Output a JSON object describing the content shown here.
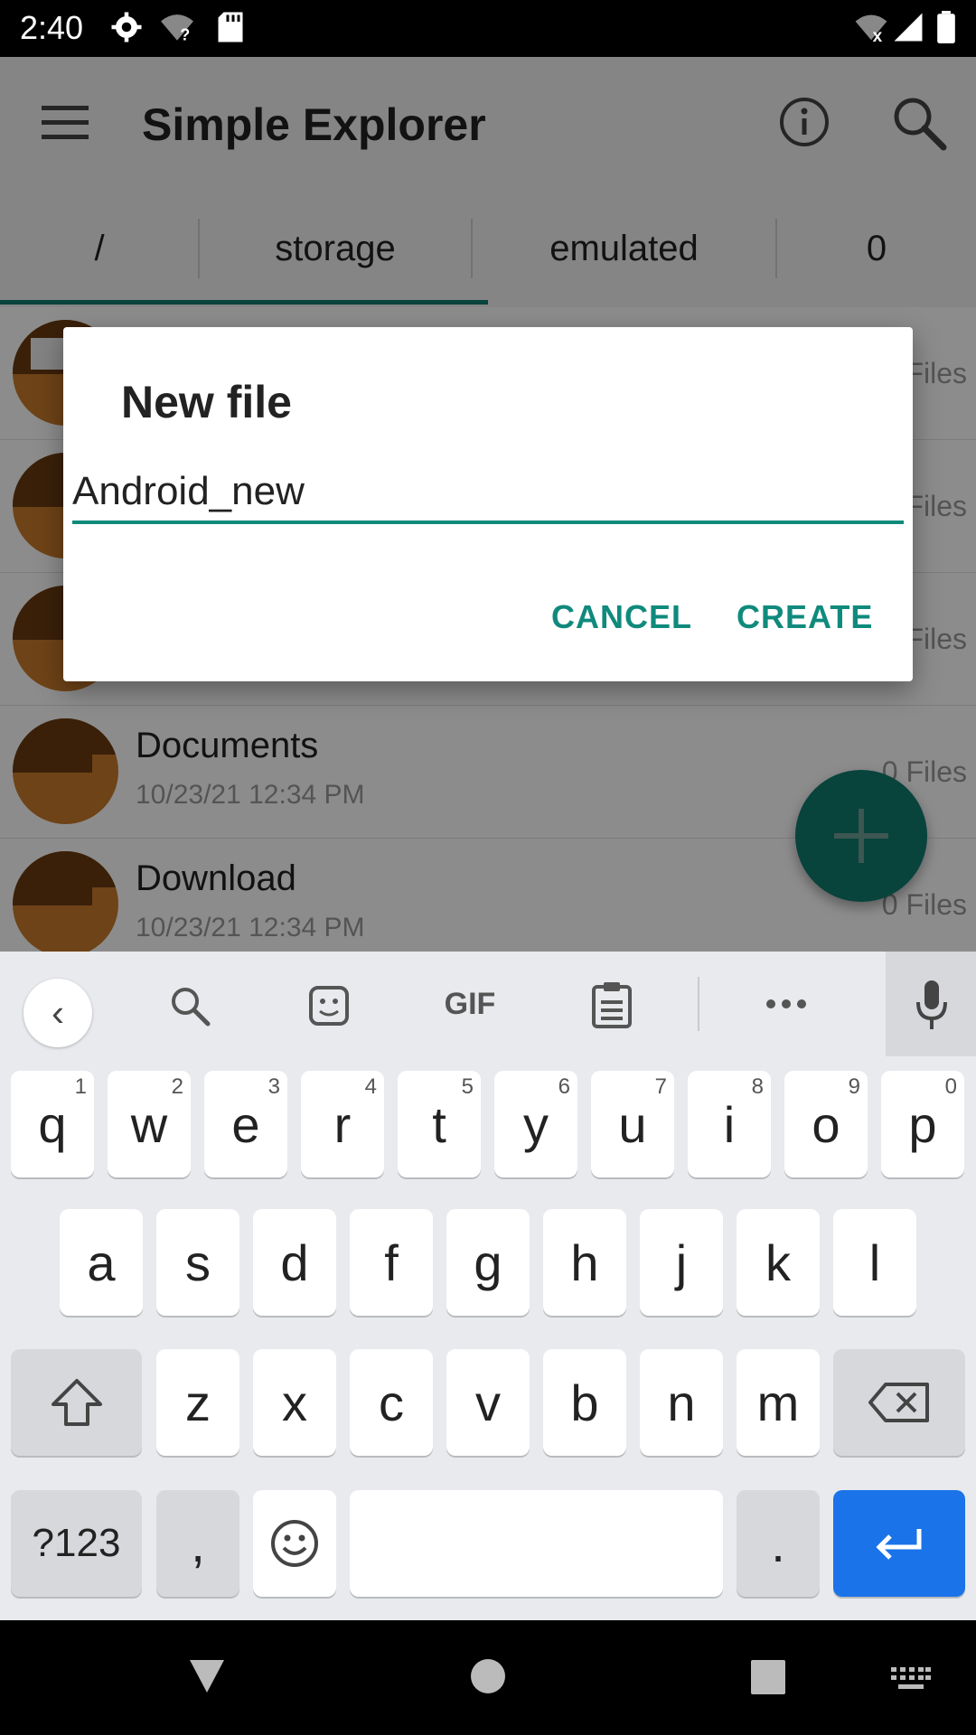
{
  "status_bar": {
    "time": "2:40"
  },
  "app_bar": {
    "title": "Simple Explorer"
  },
  "tabs": [
    {
      "label": "/"
    },
    {
      "label": "storage"
    },
    {
      "label": "emulated"
    },
    {
      "label": "0"
    }
  ],
  "list": [
    {
      "name": "",
      "date": "",
      "files": "Files"
    },
    {
      "name": "",
      "date": "",
      "files": "Files"
    },
    {
      "name": "",
      "date": "",
      "files": "Files"
    },
    {
      "name": "Documents",
      "date": "10/23/21 12:34 PM",
      "files": "0 Files"
    },
    {
      "name": "Download",
      "date": "10/23/21 12:34 PM",
      "files": "0 Files"
    }
  ],
  "dialog": {
    "title": "New file",
    "input_value": "Android_new",
    "cancel_label": "CANCEL",
    "create_label": "CREATE"
  },
  "keyboard": {
    "suggestion_gif": "GIF",
    "row1": [
      {
        "k": "q",
        "h": "1"
      },
      {
        "k": "w",
        "h": "2"
      },
      {
        "k": "e",
        "h": "3"
      },
      {
        "k": "r",
        "h": "4"
      },
      {
        "k": "t",
        "h": "5"
      },
      {
        "k": "y",
        "h": "6"
      },
      {
        "k": "u",
        "h": "7"
      },
      {
        "k": "i",
        "h": "8"
      },
      {
        "k": "o",
        "h": "9"
      },
      {
        "k": "p",
        "h": "0"
      }
    ],
    "row2": [
      "a",
      "s",
      "d",
      "f",
      "g",
      "h",
      "j",
      "k",
      "l"
    ],
    "row3": [
      "z",
      "x",
      "c",
      "v",
      "b",
      "n",
      "m"
    ],
    "symbols_label": "?123",
    "comma_label": ",",
    "period_label": "."
  }
}
